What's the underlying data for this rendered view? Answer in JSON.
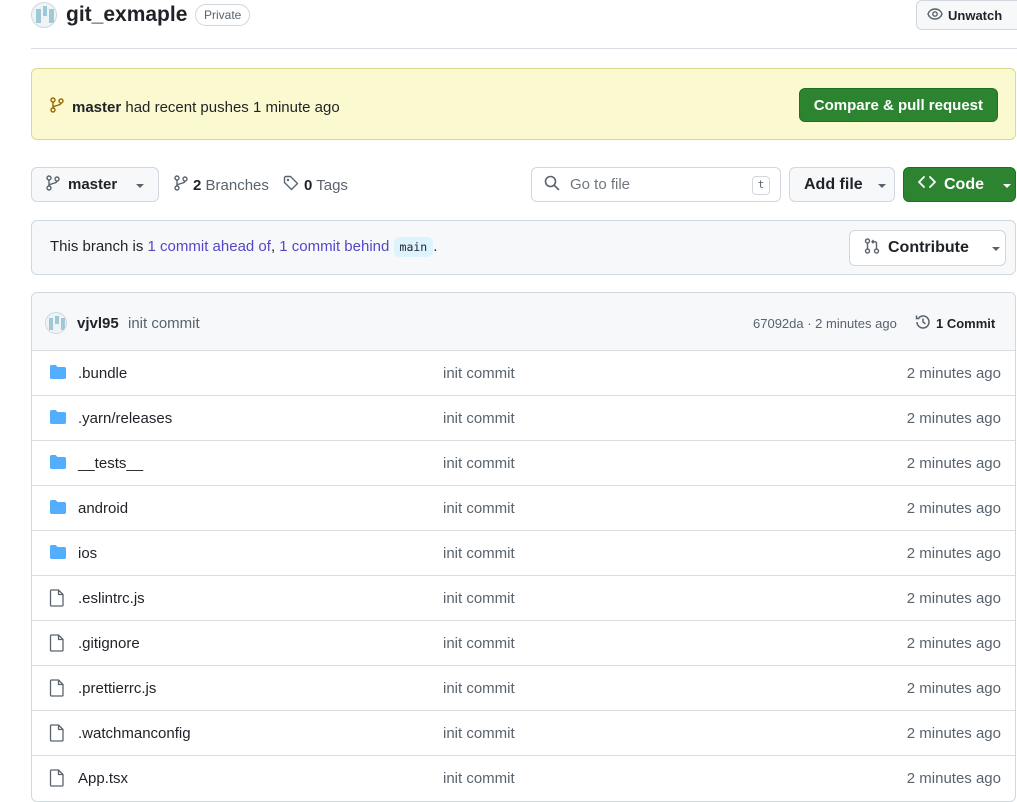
{
  "repo": {
    "name": "git_exmaple",
    "visibility": "Private"
  },
  "header": {
    "unwatch_label": "Unwatch"
  },
  "banner": {
    "branch": "master",
    "message": "had recent pushes 1 minute ago",
    "compare_label": "Compare & pull request"
  },
  "toolbar": {
    "branch": "master",
    "branches_count": "2",
    "branches_label": "Branches",
    "tags_count": "0",
    "tags_label": "Tags",
    "search_placeholder": "Go to file",
    "search_shortcut": "t",
    "add_file_label": "Add file",
    "code_label": "Code"
  },
  "branch_status": {
    "prefix": "This branch is",
    "ahead": "1 commit ahead of",
    "comma": ",",
    "behind": "1 commit behind",
    "base": "main",
    "suffix": ".",
    "contribute_label": "Contribute"
  },
  "latest_commit": {
    "author": "vjvl95",
    "message": "init commit",
    "meta": "67092da · 2 minutes ago",
    "commits_label": "1 Commit"
  },
  "files": [
    {
      "type": "dir",
      "name": ".bundle",
      "commit": "init commit",
      "time": "2 minutes ago"
    },
    {
      "type": "dir",
      "name": ".yarn/releases",
      "commit": "init commit",
      "time": "2 minutes ago"
    },
    {
      "type": "dir",
      "name": "__tests__",
      "commit": "init commit",
      "time": "2 minutes ago"
    },
    {
      "type": "dir",
      "name": "android",
      "commit": "init commit",
      "time": "2 minutes ago"
    },
    {
      "type": "dir",
      "name": "ios",
      "commit": "init commit",
      "time": "2 minutes ago"
    },
    {
      "type": "file",
      "name": ".eslintrc.js",
      "commit": "init commit",
      "time": "2 minutes ago"
    },
    {
      "type": "file",
      "name": ".gitignore",
      "commit": "init commit",
      "time": "2 minutes ago"
    },
    {
      "type": "file",
      "name": ".prettierrc.js",
      "commit": "init commit",
      "time": "2 minutes ago"
    },
    {
      "type": "file",
      "name": ".watchmanconfig",
      "commit": "init commit",
      "time": "2 minutes ago"
    },
    {
      "type": "file",
      "name": "App.tsx",
      "commit": "init commit",
      "time": "2 minutes ago"
    }
  ],
  "colors": {
    "green": "#2c8431",
    "link": "#5548c8",
    "folder": "#54aeff",
    "banner_bg": "#fbf9cf"
  }
}
